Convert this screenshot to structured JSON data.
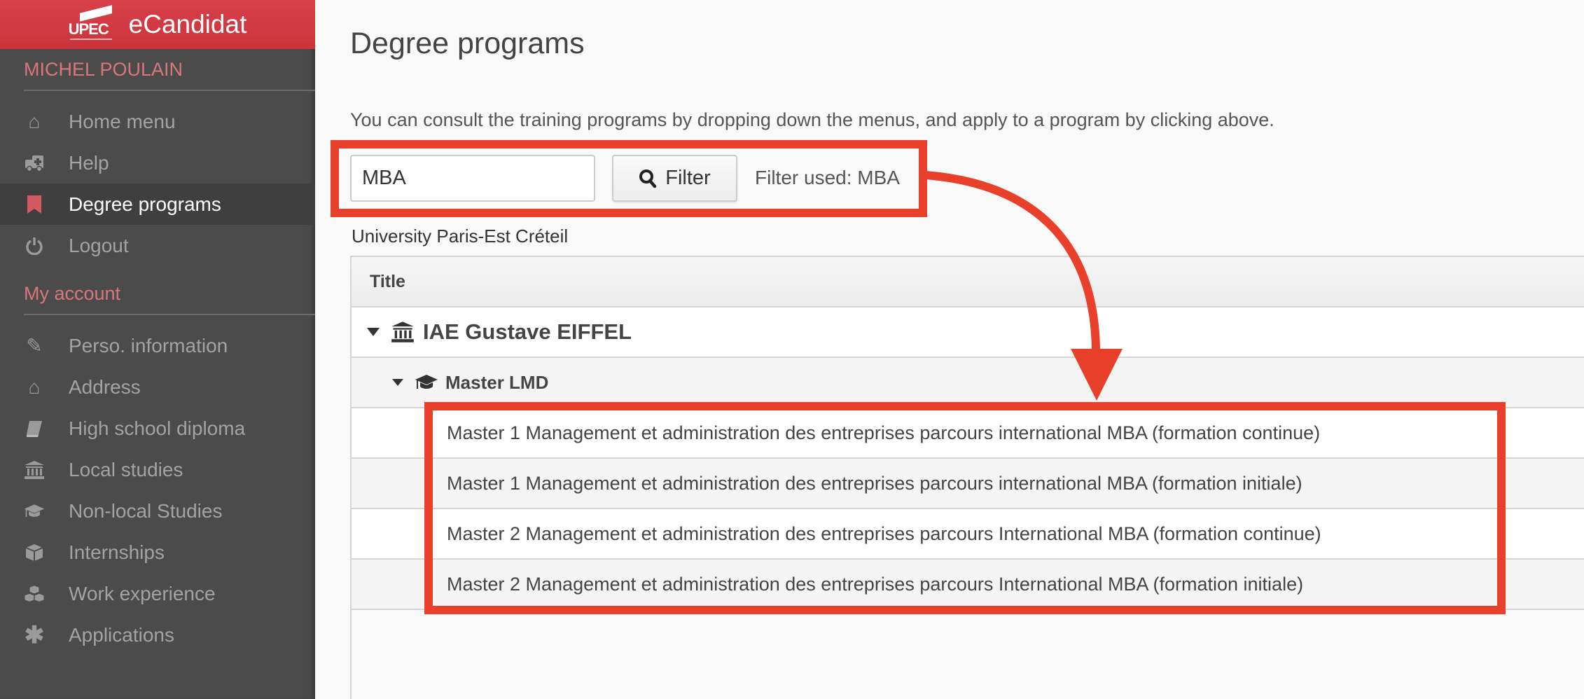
{
  "sidebar": {
    "logo_text": "UPEC",
    "app_name": "eCandidat",
    "user_name": "MICHEL POULAIN",
    "menu": [
      {
        "label": "Home menu",
        "icon": "home-icon"
      },
      {
        "label": "Help",
        "icon": "ambulance-icon"
      },
      {
        "label": "Degree programs",
        "icon": "bookmark-icon",
        "active": true
      },
      {
        "label": "Logout",
        "icon": "power-icon"
      }
    ],
    "account_title": "My account",
    "account": [
      {
        "label": "Perso. information",
        "icon": "pencil-icon"
      },
      {
        "label": "Address",
        "icon": "home-icon"
      },
      {
        "label": "High school diploma",
        "icon": "book-icon"
      },
      {
        "label": "Local studies",
        "icon": "bank-icon"
      },
      {
        "label": "Non-local Studies",
        "icon": "graduation-cap-icon"
      },
      {
        "label": "Internships",
        "icon": "cube-icon"
      },
      {
        "label": "Work experience",
        "icon": "cubes-icon"
      },
      {
        "label": "Applications",
        "icon": "asterisk-icon"
      }
    ]
  },
  "main": {
    "title": "Degree programs",
    "description": "You can consult the training programs by dropping down the menus, and apply to a program by clicking above.",
    "search_value": "MBA",
    "filter_label": "Filter",
    "filter_used": "Filter used: MBA",
    "university": "University Paris-Est Créteil",
    "table_header": "Title",
    "institution": "IAE Gustave EIFFEL",
    "degree_type": "Master LMD",
    "programs": [
      "Master 1 Management et administration des entreprises parcours international MBA (formation continue)",
      "Master 1 Management et administration des entreprises parcours international MBA (formation initiale)",
      "Master 2 Management et administration des entreprises parcours International MBA (formation continue)",
      "Master 2 Management et administration des entreprises parcours International MBA (formation initiale)"
    ]
  },
  "colors": {
    "brand": "#d33b3f",
    "highlight": "#e8402a",
    "sidebar": "#4b4b4b"
  }
}
